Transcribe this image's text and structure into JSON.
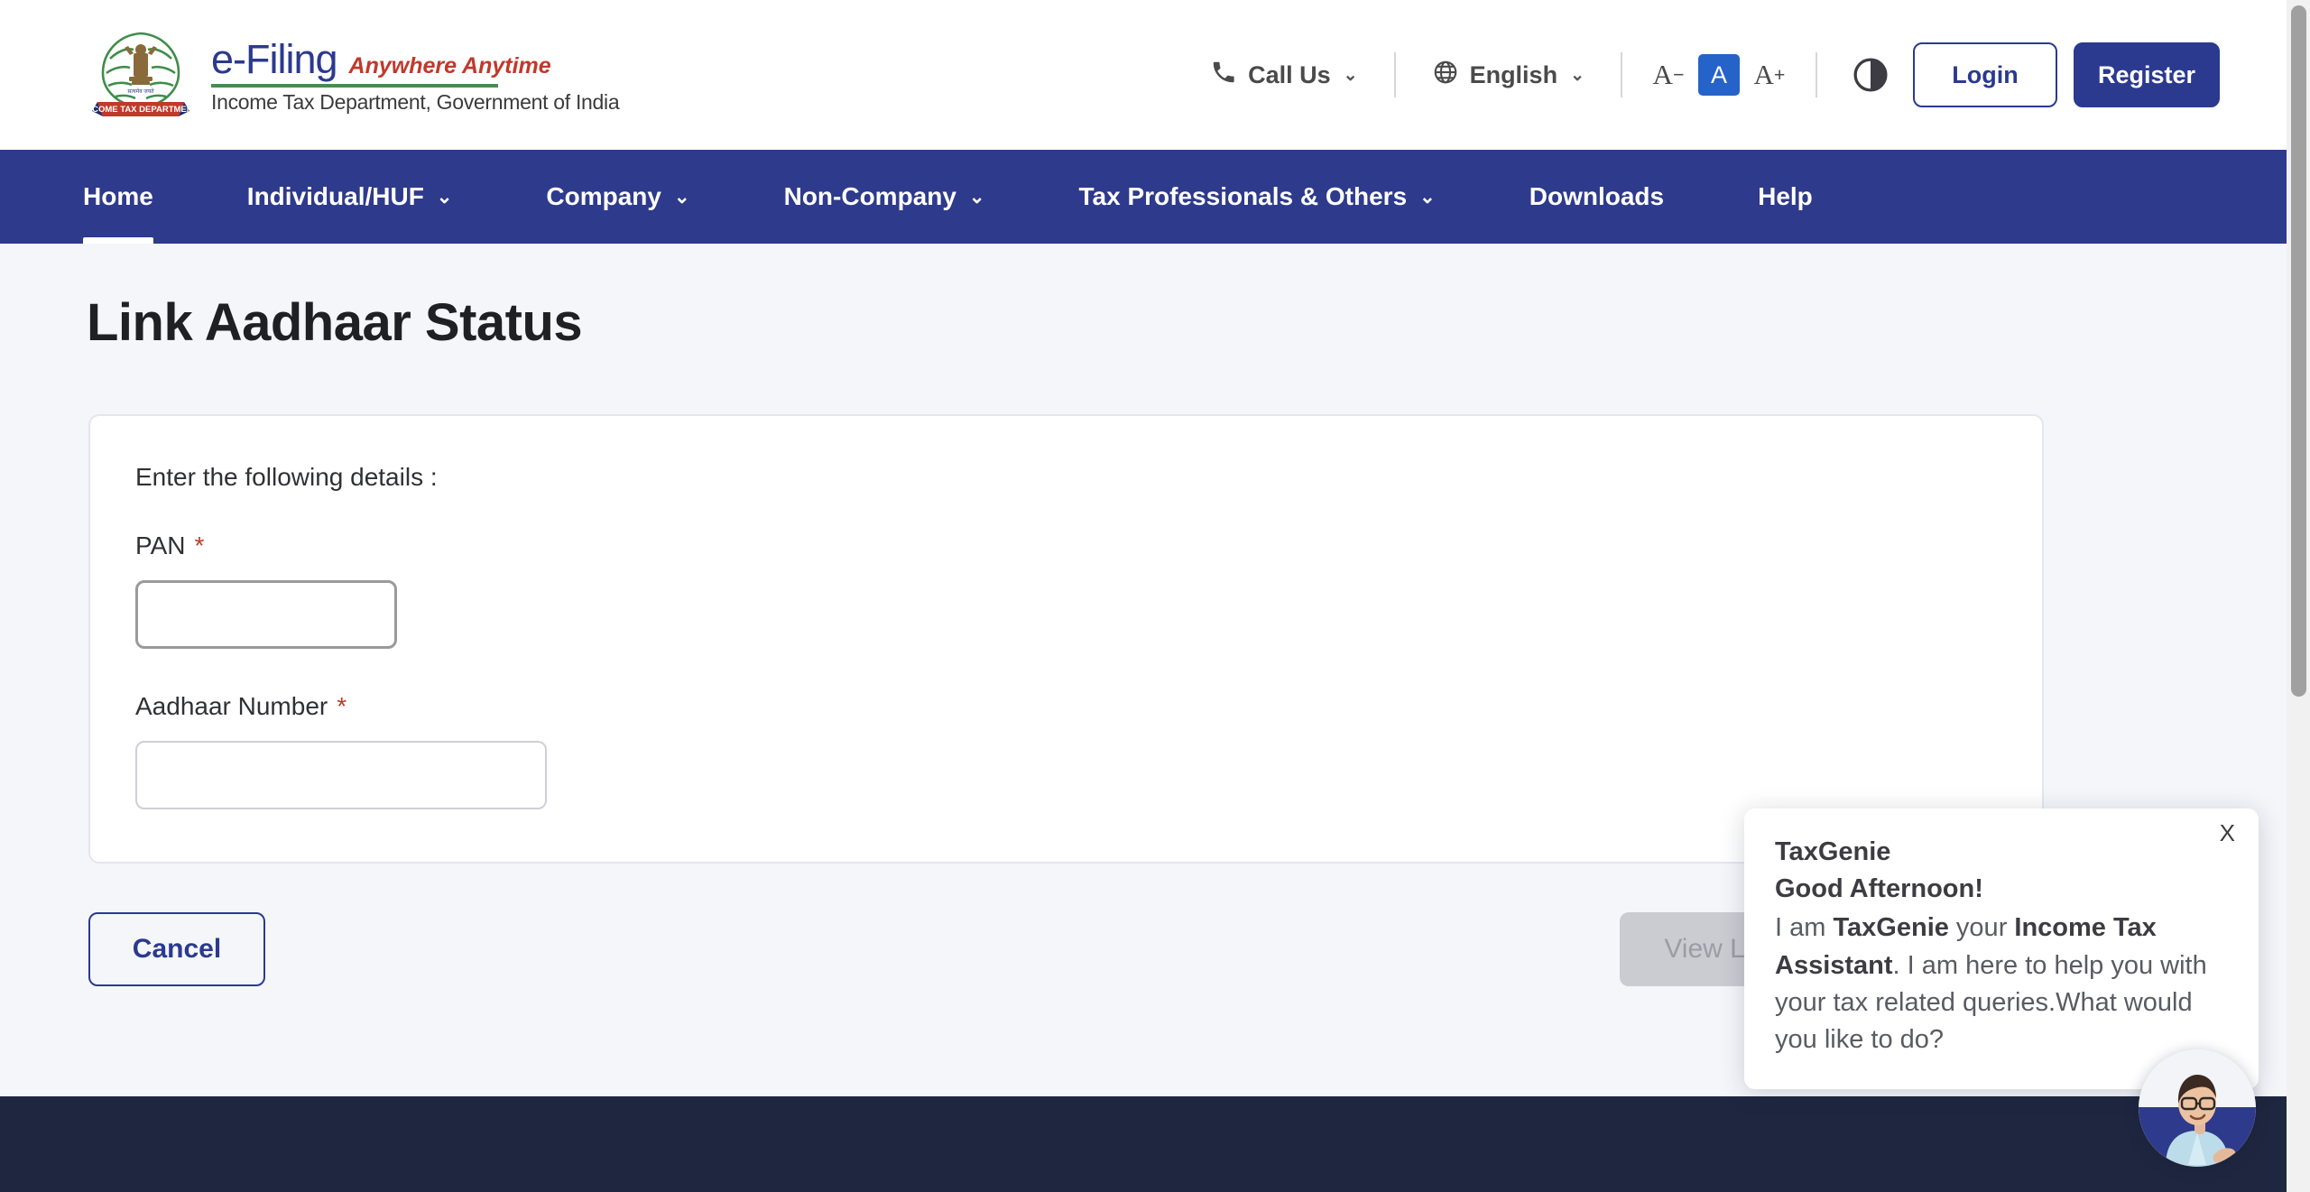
{
  "header": {
    "logo": {
      "emblem_alt": "india-emblem-income-tax-department",
      "efiling": "e-Filing",
      "tagline": "Anywhere Anytime",
      "department": "Income Tax Department, Government of India"
    },
    "call_us": "Call Us",
    "language": "English",
    "font_decrease": "A",
    "font_normal": "A",
    "font_increase": "A",
    "login": "Login",
    "register": "Register",
    "accent_blue": "#2b3a8f",
    "highlight_blue": "#2563c9"
  },
  "nav": {
    "items": [
      {
        "label": "Home",
        "has_caret": false,
        "active": true
      },
      {
        "label": "Individual/HUF",
        "has_caret": true,
        "active": false
      },
      {
        "label": "Company",
        "has_caret": true,
        "active": false
      },
      {
        "label": "Non-Company",
        "has_caret": true,
        "active": false
      },
      {
        "label": "Tax Professionals & Others",
        "has_caret": true,
        "active": false
      },
      {
        "label": "Downloads",
        "has_caret": false,
        "active": false
      },
      {
        "label": "Help",
        "has_caret": false,
        "active": false
      }
    ],
    "background": "#2e3a8c"
  },
  "page": {
    "title": "Link Aadhaar Status",
    "intro": "Enter the following details :",
    "fields": [
      {
        "label": "PAN",
        "required_marker": "*",
        "value": "",
        "placeholder": ""
      },
      {
        "label": "Aadhaar Number",
        "required_marker": "*",
        "value": "",
        "placeholder": ""
      }
    ]
  },
  "actions": {
    "cancel": "Cancel",
    "submit": "View Link Aadhaar Status",
    "submit_disabled": true
  },
  "chat": {
    "close": "X",
    "title": "TaxGenie",
    "greeting": "Good Afternoon!",
    "message_prefix": "I am ",
    "message_bold1": "TaxGenie",
    "message_mid": " your ",
    "message_bold2": "Income Tax Assistant",
    "message_suffix": ". I am here to help you with your tax related queries.What would you like to do?",
    "avatar_alt": "taxgenie-assistant-avatar"
  },
  "footer": {
    "background": "#1f2740"
  }
}
